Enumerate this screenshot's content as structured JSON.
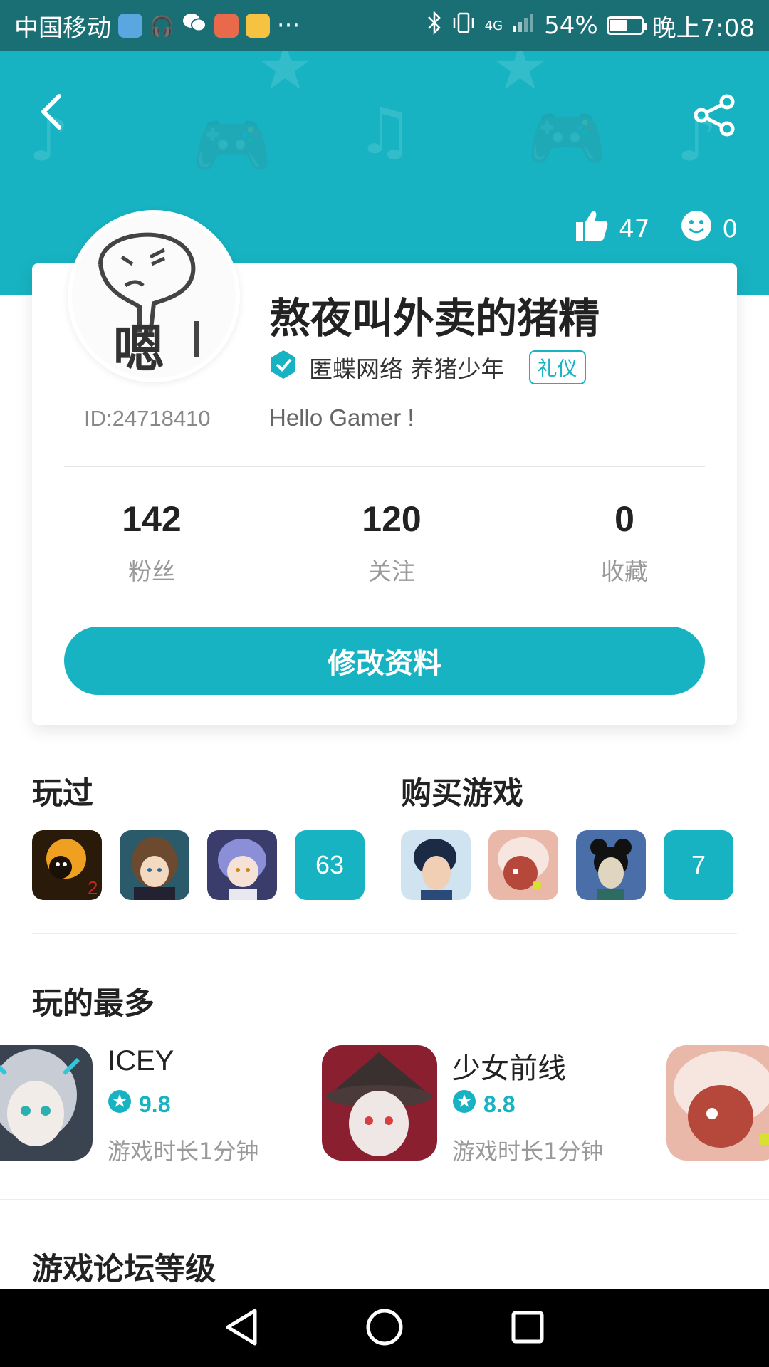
{
  "status_bar": {
    "carrier": "中国移动",
    "more": "···",
    "network": "4G",
    "battery": "54%",
    "battery_level": 0.54,
    "time": "晚上7:08"
  },
  "header": {
    "likes": "47",
    "smiles": "0",
    "accent_color": "#17b3c2"
  },
  "profile": {
    "avatar_text": "嗯",
    "id": "ID:24718410",
    "name": "熬夜叫外卖的猪精",
    "org": "匿蝶网络 养猪少年",
    "tag": "礼仪",
    "bio": "Hello Gamer !",
    "stats": [
      {
        "value": "142",
        "label": "粉丝"
      },
      {
        "value": "120",
        "label": "关注"
      },
      {
        "value": "0",
        "label": "收藏"
      }
    ],
    "edit_button": "修改资料"
  },
  "played": {
    "title": "玩过",
    "count": "63"
  },
  "purchased": {
    "title": "购买游戏",
    "count": "7"
  },
  "most_played": {
    "title": "玩的最多",
    "items": [
      {
        "name": "ICEY",
        "rating": "9.8",
        "time": "游戏时长1分钟"
      },
      {
        "name": "少女前线",
        "rating": "8.8",
        "time": "游戏时长1分钟"
      }
    ]
  },
  "forum_level": {
    "title": "游戏论坛等级"
  }
}
